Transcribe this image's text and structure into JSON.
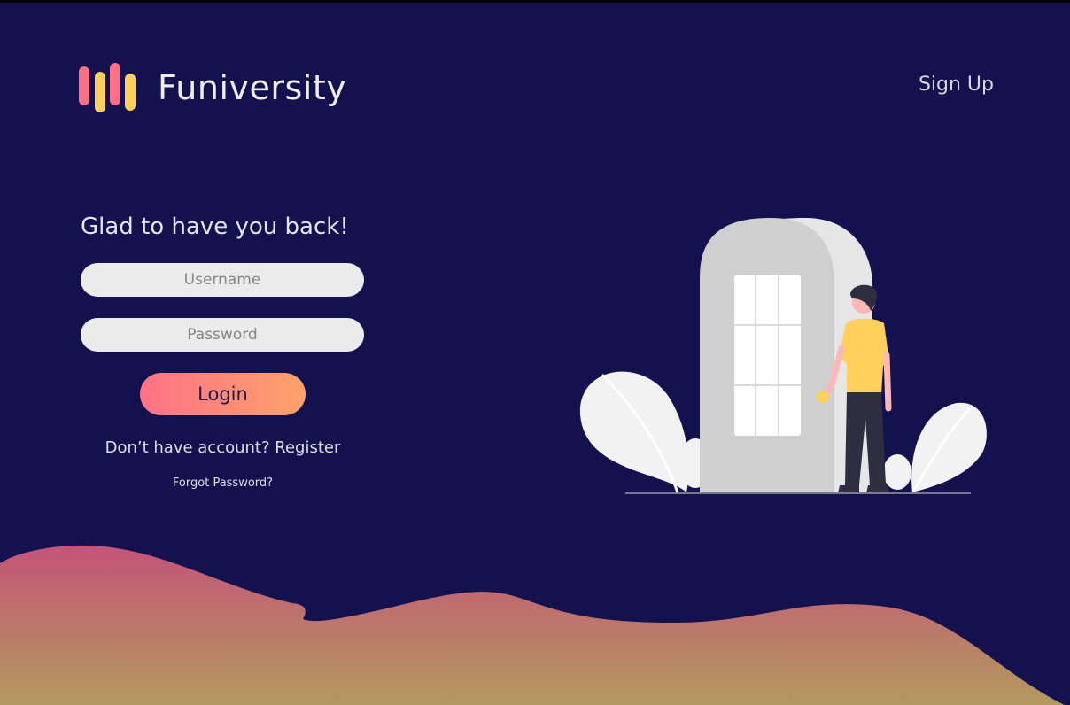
{
  "header": {
    "brand_name": "Funiversity",
    "signup_label": "Sign Up"
  },
  "login_form": {
    "heading": "Glad to have you back!",
    "username_placeholder": "Username",
    "password_placeholder": "Password",
    "login_label": "Login",
    "register_prompt": "Don’t have account?",
    "register_link": "Register",
    "forgot_password": "Forgot Password?"
  },
  "colors": {
    "background": "#14114f",
    "accent_pink": "#fe7186",
    "accent_orange": "#ffa26b",
    "accent_yellow": "#ffd15c"
  },
  "icons": {
    "logo": "funiversity-bars-logo",
    "illustration": "person-at-door-illustration"
  }
}
